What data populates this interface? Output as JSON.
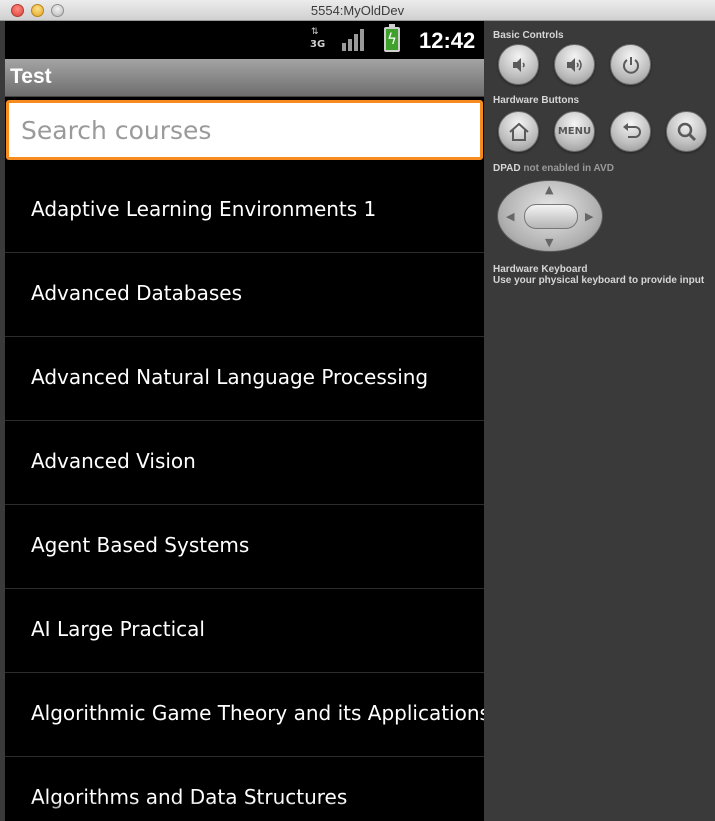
{
  "window": {
    "title": "5554:MyOldDev"
  },
  "status_bar": {
    "network": "3G",
    "time": "12:42"
  },
  "app_bar": {
    "title": "Test"
  },
  "search": {
    "placeholder": "Search courses",
    "value": ""
  },
  "courses": [
    "Adaptive Learning Environments 1",
    "Advanced Databases",
    "Advanced Natural Language Processing",
    "Advanced Vision",
    "Agent Based Systems",
    "AI Large Practical",
    "Algorithmic Game Theory and its Applications",
    "Algorithms and Data Structures"
  ],
  "controls": {
    "basic_label": "Basic Controls",
    "hardware_label": "Hardware Buttons",
    "menu_label": "MENU",
    "dpad_label": "DPAD",
    "dpad_note": "not enabled in AVD",
    "keyboard_label": "Hardware Keyboard",
    "keyboard_note": "Use your physical keyboard to provide input"
  },
  "icons": {
    "volume_down": "volume-down-icon",
    "volume_up": "volume-up-icon",
    "power": "power-icon",
    "home": "home-icon",
    "back": "back-icon",
    "search": "search-icon"
  },
  "colors": {
    "search_focus": "#f78b1f",
    "battery": "#3fa02b"
  }
}
